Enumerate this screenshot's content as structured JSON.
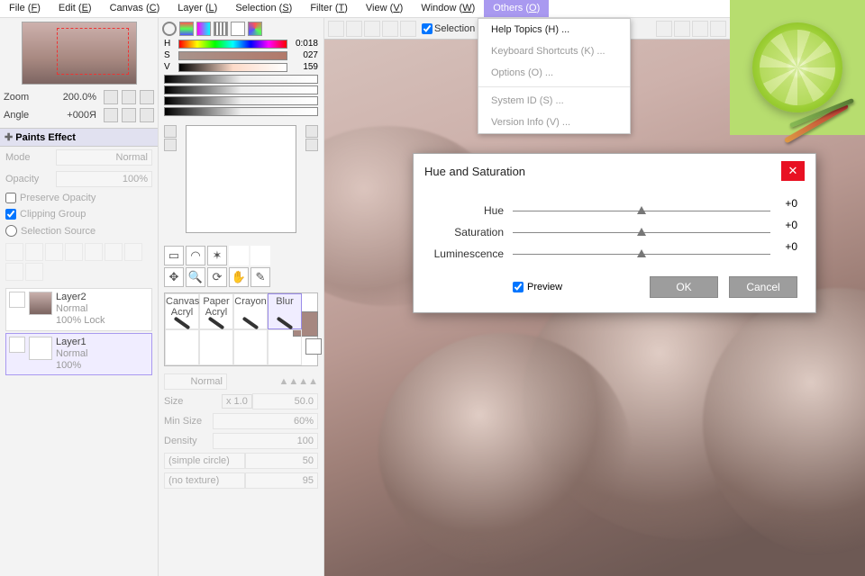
{
  "menu": {
    "items": [
      {
        "label": "File",
        "accel": "F"
      },
      {
        "label": "Edit",
        "accel": "E"
      },
      {
        "label": "Canvas",
        "accel": "C"
      },
      {
        "label": "Layer",
        "accel": "L"
      },
      {
        "label": "Selection",
        "accel": "S"
      },
      {
        "label": "Filter",
        "accel": "T"
      },
      {
        "label": "View",
        "accel": "V"
      },
      {
        "label": "Window",
        "accel": "W"
      },
      {
        "label": "Others",
        "accel": "O"
      }
    ]
  },
  "others_menu": {
    "items": [
      {
        "label": "Help Topics (",
        "accel": "H",
        "tail": ") ..."
      },
      {
        "label": "Keyboard Shortcuts (",
        "accel": "K",
        "tail": ") ..."
      },
      {
        "label": "Options (",
        "accel": "O",
        "tail": ") ..."
      },
      {
        "label": "System ID (",
        "accel": "S",
        "tail": ") ..."
      },
      {
        "label": "Version Info (",
        "accel": "V",
        "tail": ") ..."
      }
    ]
  },
  "nav": {
    "zoom_label": "Zoom",
    "zoom_value": "200.0%",
    "angle_label": "Angle",
    "angle_value": "+000Я"
  },
  "paints": {
    "header": "Paints Effect",
    "mode_label": "Mode",
    "mode_value": "Normal",
    "opacity_label": "Opacity",
    "opacity_value": "100%",
    "preserve": "Preserve Opacity",
    "clipping": "Clipping Group",
    "selection_src": "Selection Source"
  },
  "layers": [
    {
      "name": "Layer2",
      "mode": "Normal",
      "opacity": "100%",
      "lock": "Lock"
    },
    {
      "name": "Layer1",
      "mode": "Normal",
      "opacity": "100%",
      "lock": ""
    }
  ],
  "hsv": {
    "h_label": "H",
    "h_val": "0:018",
    "s_label": "S",
    "s_val": "027",
    "v_label": "V",
    "v_val": "159"
  },
  "brushes": [
    "Canvas Acryl",
    "Paper Acryl",
    "Crayon",
    "Blur"
  ],
  "brush_mode": "Normal",
  "brush_params": {
    "size_label": "Size",
    "size_mult": "x 1.0",
    "size_val": "50.0",
    "min_label": "Min Size",
    "min_val": "60%",
    "dens_label": "Density",
    "dens_val": "100",
    "shape": "(simple circle)",
    "shape_val": "50",
    "tex": "(no texture)",
    "tex_val": "95"
  },
  "toolbar2": {
    "selection": "Selection"
  },
  "dialog": {
    "title": "Hue and Saturation",
    "hue": "Hue",
    "sat": "Saturation",
    "lum": "Luminescence",
    "val": "+0",
    "preview": "Preview",
    "ok": "OK",
    "cancel": "Cancel"
  }
}
